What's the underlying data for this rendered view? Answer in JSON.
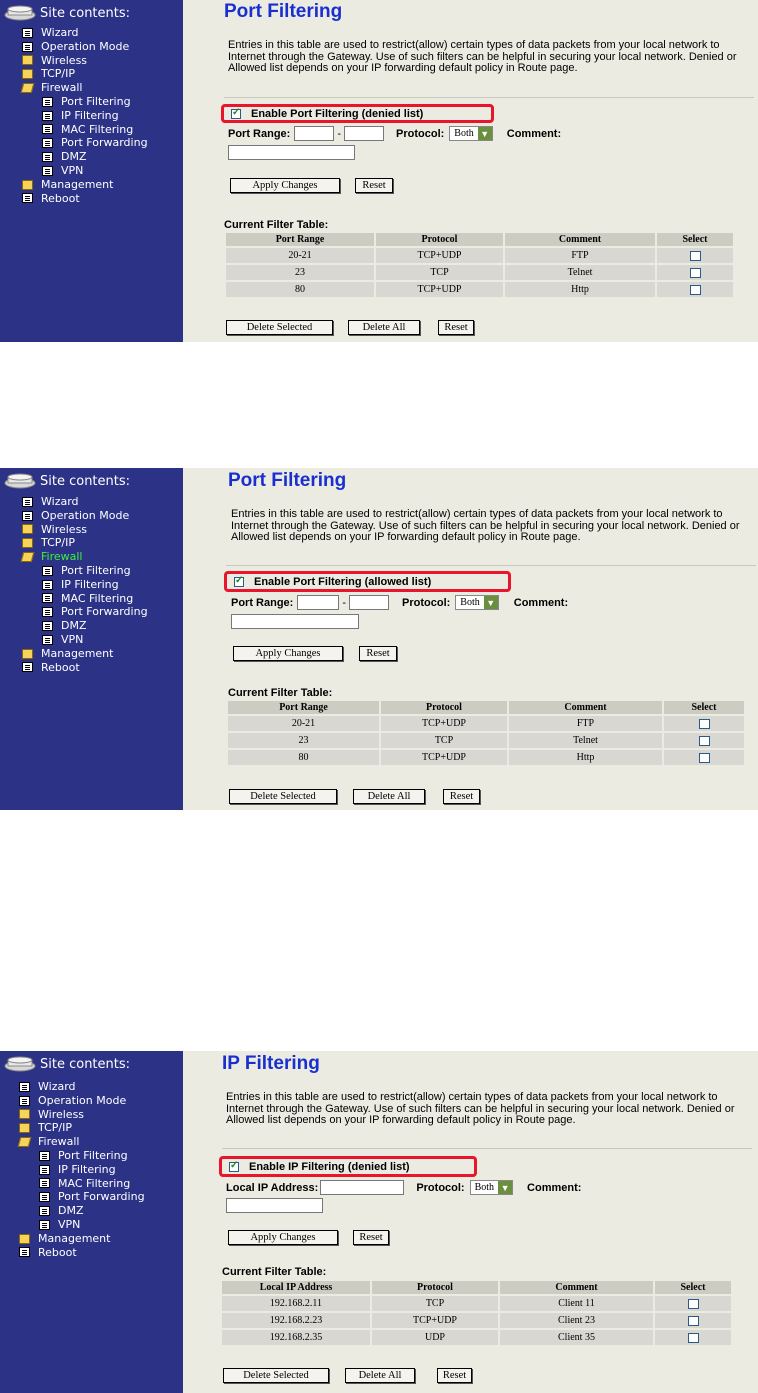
{
  "sidebar": {
    "header": "Site contents:",
    "items": [
      {
        "label": "Wizard",
        "icon": "page-icon"
      },
      {
        "label": "Operation Mode",
        "icon": "page-icon"
      },
      {
        "label": "Wireless",
        "icon": "folder-icon"
      },
      {
        "label": "TCP/IP",
        "icon": "folder-icon"
      },
      {
        "label": "Firewall",
        "icon": "folder-open-icon"
      },
      {
        "label": "Port Filtering",
        "icon": "page-icon",
        "sub": true
      },
      {
        "label": "IP Filtering",
        "icon": "page-icon",
        "sub": true
      },
      {
        "label": "MAC Filtering",
        "icon": "page-icon",
        "sub": true
      },
      {
        "label": "Port Forwarding",
        "icon": "page-icon",
        "sub": true
      },
      {
        "label": "DMZ",
        "icon": "page-icon",
        "sub": true
      },
      {
        "label": "VPN",
        "icon": "page-icon",
        "sub": true
      },
      {
        "label": "Management",
        "icon": "folder-icon"
      },
      {
        "label": "Reboot",
        "icon": "page-icon"
      }
    ]
  },
  "description": "Entries in this table are used to restrict(allow) certain types of data packets from your local network to Internet through the Gateway. Use of such filters can be helpful in securing your local network. Denied or Allowed list depends on your IP forwarding default policy in Route page.",
  "common": {
    "protocol_label": "Protocol:",
    "protocol_value": "Both",
    "comment_label": "Comment:",
    "apply_label": "Apply Changes",
    "reset_label": "Reset",
    "delete_selected_label": "Delete Selected",
    "delete_all_label": "Delete All",
    "table_title": "Current Filter Table:",
    "col_protocol": "Protocol",
    "col_comment": "Comment",
    "col_select": "Select"
  },
  "shot1": {
    "title": "Port Filtering",
    "enable_label": "Enable Port Filtering (denied list)",
    "range_label": "Port Range:",
    "range_sep": "-",
    "col_first": "Port Range",
    "rows": [
      {
        "a": "20-21",
        "p": "TCP+UDP",
        "c": "FTP"
      },
      {
        "a": "23",
        "p": "TCP",
        "c": "Telnet"
      },
      {
        "a": "80",
        "p": "TCP+UDP",
        "c": "Http"
      }
    ]
  },
  "shot2": {
    "title": "Port Filtering",
    "enable_label": "Enable Port Filtering (allowed list)",
    "range_label": "Port Range:",
    "range_sep": "-",
    "col_first": "Port Range",
    "highlight_item": "Firewall",
    "rows": [
      {
        "a": "20-21",
        "p": "TCP+UDP",
        "c": "FTP"
      },
      {
        "a": "23",
        "p": "TCP",
        "c": "Telnet"
      },
      {
        "a": "80",
        "p": "TCP+UDP",
        "c": "Http"
      }
    ]
  },
  "shot3": {
    "title": "IP Filtering",
    "enable_label": "Enable IP Filtering (denied list)",
    "range_label": "Local IP Address:",
    "col_first": "Local IP Address",
    "rows": [
      {
        "a": "192.168.2.11",
        "p": "TCP",
        "c": "Client 11"
      },
      {
        "a": "192.168.2.23",
        "p": "TCP+UDP",
        "c": "Client 23"
      },
      {
        "a": "192.168.2.35",
        "p": "UDP",
        "c": "Client 35"
      }
    ]
  },
  "colors": {
    "sidebar_bg": "#2c3286",
    "content_bg": "#ecebe2",
    "title": "#1a2fd0",
    "highlight_border": "#e8152b",
    "active_item": "#3cf03c"
  }
}
